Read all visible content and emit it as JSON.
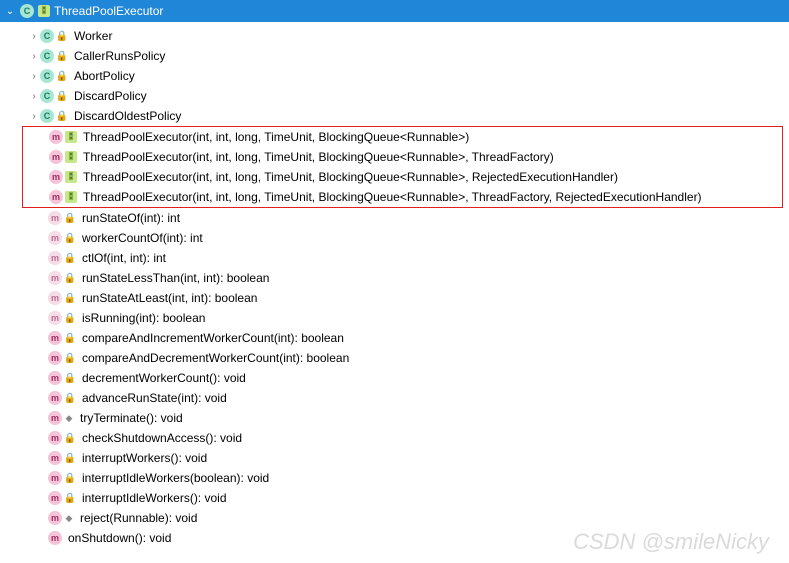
{
  "header": {
    "title": "ThreadPoolExecutor"
  },
  "classes": [
    {
      "label": "Worker"
    },
    {
      "label": "CallerRunsPolicy"
    },
    {
      "label": "AbortPolicy"
    },
    {
      "label": "DiscardPolicy"
    },
    {
      "label": "DiscardOldestPolicy"
    }
  ],
  "constructors": [
    {
      "label": "ThreadPoolExecutor(int, int, long, TimeUnit, BlockingQueue<Runnable>)"
    },
    {
      "label": "ThreadPoolExecutor(int, int, long, TimeUnit, BlockingQueue<Runnable>, ThreadFactory)"
    },
    {
      "label": "ThreadPoolExecutor(int, int, long, TimeUnit, BlockingQueue<Runnable>, RejectedExecutionHandler)"
    },
    {
      "label": "ThreadPoolExecutor(int, int, long, TimeUnit, BlockingQueue<Runnable>, ThreadFactory, RejectedExecutionHandler)"
    }
  ],
  "methods": [
    {
      "label": "runStateOf(int): int",
      "private": true,
      "static": true
    },
    {
      "label": "workerCountOf(int): int",
      "private": true,
      "static": true
    },
    {
      "label": "ctlOf(int, int): int",
      "private": true,
      "static": true
    },
    {
      "label": "runStateLessThan(int, int): boolean",
      "private": true,
      "static": true
    },
    {
      "label": "runStateAtLeast(int, int): boolean",
      "private": true,
      "static": true
    },
    {
      "label": "isRunning(int): boolean",
      "private": true,
      "static": true
    },
    {
      "label": "compareAndIncrementWorkerCount(int): boolean",
      "private": true
    },
    {
      "label": "compareAndDecrementWorkerCount(int): boolean",
      "private": true
    },
    {
      "label": "decrementWorkerCount(): void",
      "private": true
    },
    {
      "label": "advanceRunState(int): void",
      "private": true
    },
    {
      "label": "tryTerminate(): void",
      "final": true
    },
    {
      "label": "checkShutdownAccess(): void",
      "private": true
    },
    {
      "label": "interruptWorkers(): void",
      "private": true
    },
    {
      "label": "interruptIdleWorkers(boolean): void",
      "private": true
    },
    {
      "label": "interruptIdleWorkers(): void",
      "private": true
    },
    {
      "label": "reject(Runnable): void",
      "final": true
    },
    {
      "label": "onShutdown(): void"
    }
  ],
  "watermark": "CSDN @smileNicky"
}
